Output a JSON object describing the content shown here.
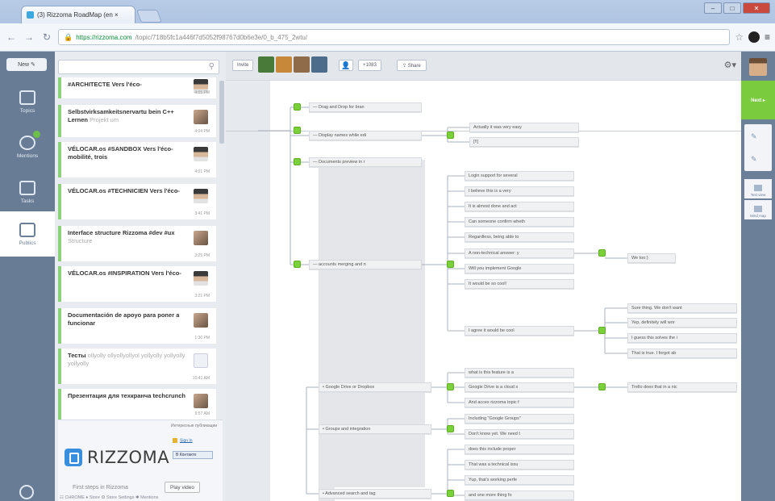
{
  "browser": {
    "tab_title": "(3) Rizzoma RoadMap (en ×",
    "tab_close": "×",
    "url_host": "https://rizzoma.com",
    "url_path": "/topic/718b5fc1a446f7d5052f98767d0b6e3e/0_b_475_2wtu/",
    "window_buttons": {
      "minimize": "–",
      "maximize": "□",
      "close": "✕"
    }
  },
  "rail": {
    "new_button": "New ✎",
    "items": [
      {
        "label": "Topics"
      },
      {
        "label": "Mentions"
      },
      {
        "label": "Tasks"
      },
      {
        "label": "Publics"
      }
    ]
  },
  "list": {
    "topics": [
      {
        "title": "#ARCHITECTE Vers l'éco-",
        "snippet": "",
        "time": "4:05 PM"
      },
      {
        "title": "Selbstvirksamkeitsnervartu bein C++ Lernen",
        "snippet": "Projekt um",
        "time": "4:04 PM"
      },
      {
        "title": "VÉLOCAR.os #SANDBOX Vers l'éco-mobilité, trois",
        "snippet": "",
        "time": "4:01 PM"
      },
      {
        "title": "VÉLOCAR.os #TECHNICIEN Vers l'éco-",
        "snippet": "",
        "time": "3:41 PM"
      },
      {
        "title": "Interface structure Rizzoma #dev #ux",
        "snippet": "Structure",
        "time": "3:25 PM"
      },
      {
        "title": "VÉLOCAR.os #INSPIRATION Vers l'éco-",
        "snippet": "",
        "time": "3:21 PM"
      },
      {
        "title": "Documentación de apoyo para poner a funcionar",
        "snippet": "",
        "time": "1:30 PM"
      },
      {
        "title": "Тесты",
        "snippet": "ollyolly ollyollyollyol yollyolly yollyolly yollyolly",
        "time": "10:41 AM"
      },
      {
        "title": "Презентация для техкранча techcrunch",
        "snippet": "",
        "time": "9:57 AM"
      }
    ],
    "promo": {
      "popular_label": "Интересные публикации",
      "brand": "RIZZOMA",
      "signin": "Sign In",
      "vk_button": "В Контакте",
      "first_steps": "First steps in Rizzoma",
      "play_video": "Play video"
    },
    "footer_links": "☷ CHROME ♦ Store   ⚙ Store Settings   ✱ Mentions"
  },
  "main": {
    "invite": "Invite",
    "more_people": "+1083",
    "share": "⇪ Share",
    "gear": "⚙▾",
    "avatar_colors": [
      "#4a7a3a",
      "#c8883a",
      "#8f6b4a",
      "#4d6b8a"
    ],
    "nodes": [
      "— Drag and Drop for bran",
      "— Display names while edi",
      "Actually it was very easy",
      "[!!]",
      "— Documents preview in r",
      "Login support for several",
      "I believe this is a very",
      "It is almost done and act",
      "Can someone confirm wheth",
      "Regardless, being able to",
      "A non-technical answer: y",
      "Will you implement Google",
      "It would be so cool!",
      "— accounts merging and n",
      "We too:)",
      "Sure thing. We don't want",
      "Yep, definitely will wor",
      "I agree it would be cool",
      "I guess this solves the i",
      "That is true. I forgot ab",
      "what is this feature is a",
      "• Google Drive or Dropbox",
      "Google Drive is a cloud s",
      "Trello does that in a nic",
      "And acces rizzoma topic f",
      "Including \"Google Groups\"",
      "• Groups and integration",
      "Don't know yet. We need t",
      "does this include proper",
      "That was a technical issu",
      "Yup, that's working perfe",
      "• Advanced search and tag",
      "and one more thing fo"
    ]
  },
  "right": {
    "next": "Next ▸",
    "tools": [
      "Text view",
      "Mind map"
    ]
  }
}
